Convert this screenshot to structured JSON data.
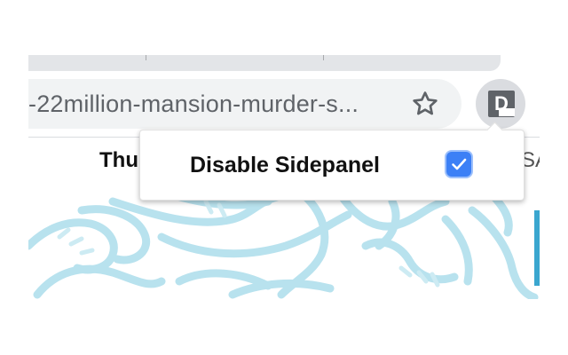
{
  "browser": {
    "address_bar": {
      "url_text": "-22million-mansion-murder-s..."
    },
    "bookmark_icon": "star-icon",
    "extension": {
      "icon_letter": "D",
      "icon": "extension-d-icon"
    },
    "bookmarks_bar": {
      "left_text": "Thu",
      "right_text": "SA"
    }
  },
  "popup": {
    "label": "Disable Sidepanel",
    "checkbox_checked": true
  },
  "colors": {
    "accent": "#3c80f6",
    "page_art": "#b8e2ee",
    "page_bar": "#3aa6cf"
  }
}
